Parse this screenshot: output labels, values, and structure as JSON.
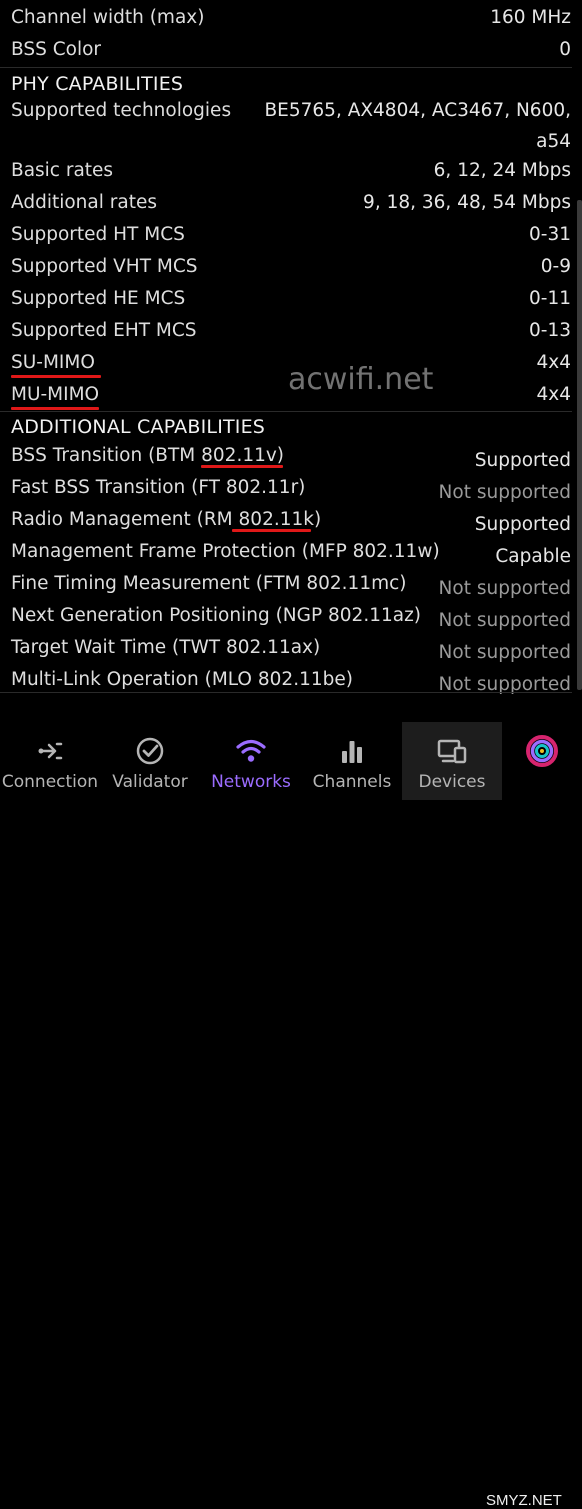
{
  "rows_top": [
    {
      "label": "Channel width (max)",
      "value": "160 MHz"
    },
    {
      "label": "BSS Color",
      "value": "0"
    }
  ],
  "phy": {
    "heading": "PHY CAPABILITIES",
    "rows": [
      {
        "label": "Supported technologies",
        "value": "BE5765, AX4804, AC3467, N600, a54"
      },
      {
        "label": "Basic rates",
        "value": "6, 12, 24 Mbps"
      },
      {
        "label": "Additional rates",
        "value": "9, 18, 36, 48, 54 Mbps"
      },
      {
        "label": "Supported HT MCS",
        "value": "0-31"
      },
      {
        "label": "Supported VHT MCS",
        "value": "0-9"
      },
      {
        "label": "Supported HE MCS",
        "value": "0-11"
      },
      {
        "label": "Supported EHT MCS",
        "value": "0-13"
      },
      {
        "label": "SU-MIMO",
        "value": "4x4"
      },
      {
        "label": "MU-MIMO",
        "value": "4x4"
      }
    ]
  },
  "additional": {
    "heading": "ADDITIONAL CAPABILITIES",
    "rows": [
      {
        "label": "BSS Transition (BTM 802.11v)",
        "value": "Supported"
      },
      {
        "label": "Fast BSS Transition (FT 802.11r)",
        "value": "Not supported"
      },
      {
        "label": "Radio Management (RM 802.11k)",
        "value": "Supported"
      },
      {
        "label": "Management Frame Protection (MFP 802.11w)",
        "value": "Capable"
      },
      {
        "label": "Fine Timing Measurement (FTM 802.11mc)",
        "value": "Not supported"
      },
      {
        "label": "Next Generation Positioning (NGP 802.11az)",
        "value": "Not supported"
      },
      {
        "label": "Target Wait Time (TWT 802.11ax)",
        "value": "Not supported"
      },
      {
        "label": "Multi-Link Operation (MLO 802.11be)",
        "value": "Not supported"
      }
    ]
  },
  "watermark": "acwifi.net",
  "watermark_corner": "SMYZ.NET",
  "nav": [
    {
      "label": "Connection",
      "icon": "connection-icon"
    },
    {
      "label": "Validator",
      "icon": "validator-check-icon"
    },
    {
      "label": "Networks",
      "icon": "wifi-icon",
      "active": true
    },
    {
      "label": "Channels",
      "icon": "bar-chart-icon"
    },
    {
      "label": "Devices",
      "icon": "devices-icon",
      "selected": true
    },
    {
      "label": "",
      "icon": "app-logo-icon"
    }
  ],
  "colors": {
    "accent": "#9b6cff",
    "underline": "#e01818",
    "muted": "#9a9a9a",
    "background": "#000000"
  }
}
